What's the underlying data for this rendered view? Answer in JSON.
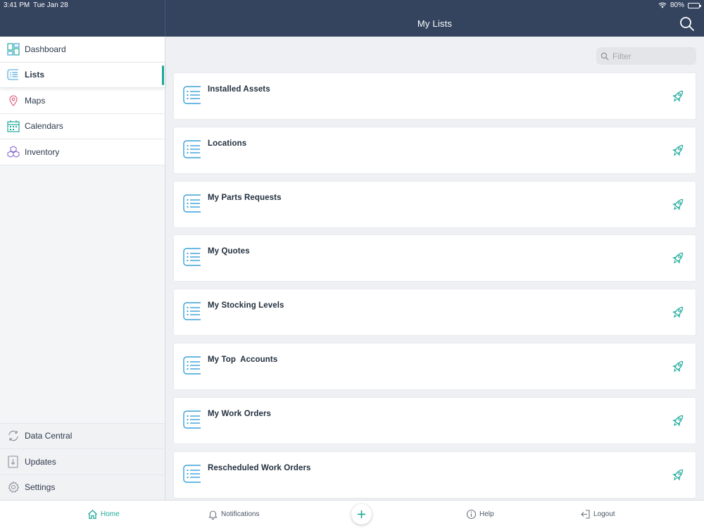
{
  "status": {
    "time": "3:41 PM",
    "date": "Tue Jan 28",
    "battery": "80%",
    "battery_level": 0.8
  },
  "header": {
    "title": "My Lists"
  },
  "sidebar": {
    "items": [
      {
        "label": "Dashboard",
        "icon": "dashboard-icon"
      },
      {
        "label": "Lists",
        "icon": "list-icon",
        "active": true
      },
      {
        "label": "Maps",
        "icon": "map-pin-icon"
      },
      {
        "label": "Calendars",
        "icon": "calendar-icon"
      },
      {
        "label": "Inventory",
        "icon": "boxes-icon"
      }
    ],
    "bottom_items": [
      {
        "label": "Data Central",
        "icon": "sync-icon"
      },
      {
        "label": "Updates",
        "icon": "download-icon"
      },
      {
        "label": "Settings",
        "icon": "gear-icon"
      }
    ]
  },
  "filter": {
    "placeholder": "Filter",
    "value": ""
  },
  "lists": [
    {
      "title": "Installed Assets"
    },
    {
      "title": "Locations"
    },
    {
      "title": "My Parts Requests"
    },
    {
      "title": "My Quotes"
    },
    {
      "title": "My Stocking Levels"
    },
    {
      "title": "My Top  Accounts"
    },
    {
      "title": "My Work Orders"
    },
    {
      "title": "Rescheduled Work Orders"
    }
  ],
  "tabbar": {
    "home": "Home",
    "notifications": "Notifications",
    "help": "Help",
    "logout": "Logout"
  },
  "colors": {
    "header": "#34435e",
    "accent": "#1ca99a",
    "list_icon": "#3aa0d8"
  }
}
